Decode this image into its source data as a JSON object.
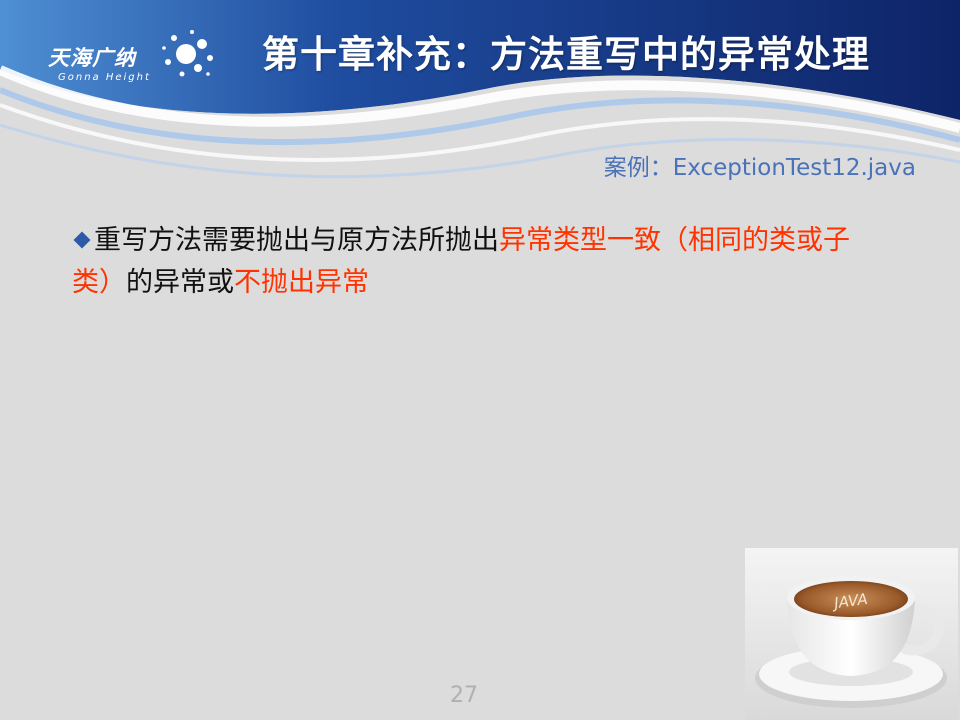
{
  "header": {
    "logo_cn": "天海广纳",
    "logo_en": "Gonna Height",
    "title": "第十章补充：方法重写中的异常处理"
  },
  "case_label": "案例：ExceptionTest12.java",
  "bullet": {
    "part1": "重写方法需要抛出与原方法所抛出",
    "part2": "异常类型一致（相同的类或子类）",
    "part3": "的异常或",
    "part4": "不抛出异常"
  },
  "image": {
    "cup_text": "JAVA"
  },
  "page_number": "27",
  "colors": {
    "background": "#dcdcdc",
    "banner_dark": "#16307a",
    "case_label": "#4a72b8",
    "highlight": "#ff3300",
    "bullet_mark": "#2d5aa8"
  }
}
